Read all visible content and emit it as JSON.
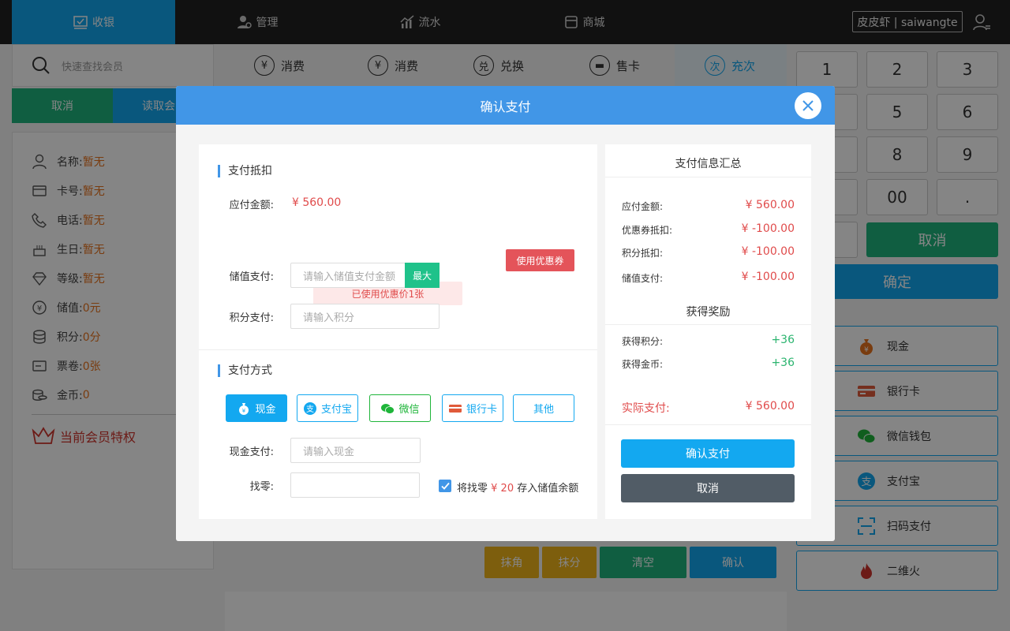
{
  "nav": {
    "items": [
      {
        "label": "收银",
        "icon": "cashier-icon"
      },
      {
        "label": "管理",
        "icon": "manage-icon"
      },
      {
        "label": "流水",
        "icon": "chart-icon"
      },
      {
        "label": "商城",
        "icon": "shop-icon"
      }
    ],
    "user": "皮皮虾 | saiwangte"
  },
  "left": {
    "search_placeholder": "快速查找会员",
    "cancel": "取消",
    "read_card": "读取会",
    "fields": [
      {
        "label": "名称:",
        "value": "暂无",
        "icon": "user-icon"
      },
      {
        "label": "卡号:",
        "value": "暂无",
        "icon": "card-icon"
      },
      {
        "label": "电话:",
        "value": "暂无",
        "icon": "phone-icon"
      },
      {
        "label": "生日:",
        "value": "暂无",
        "icon": "cake-icon"
      },
      {
        "label": "等级:",
        "value": "暂无",
        "icon": "diamond-icon"
      },
      {
        "label": "储值:",
        "value": "0元",
        "icon": "yuan-icon"
      },
      {
        "label": "积分:",
        "value": "0分",
        "icon": "database-icon"
      },
      {
        "label": "票卷:",
        "value": "0张",
        "icon": "ticket-icon"
      },
      {
        "label": "金币:",
        "value": "0",
        "icon": "coins-icon"
      }
    ],
    "privilege": "当前会员特权"
  },
  "middle": {
    "tabs": [
      {
        "label": "消费",
        "glyph": "¥"
      },
      {
        "label": "消费",
        "glyph": "¥"
      },
      {
        "label": "兑换",
        "glyph": "兑"
      },
      {
        "label": "售卡",
        "glyph": "▬"
      },
      {
        "label": "充次",
        "glyph": "次"
      }
    ],
    "buttons": {
      "round_jiao": "抹角",
      "round_fen": "抹分",
      "clear": "清空",
      "confirm": "确认"
    }
  },
  "keypad": {
    "keys": [
      "1",
      "2",
      "3",
      "5",
      "6",
      "8",
      "9",
      "00",
      "."
    ],
    "cancel": "取消",
    "ok": "确定",
    "methods": [
      "现金",
      "银行卡",
      "微信钱包",
      "支付宝",
      "扫码支付",
      "二维火"
    ]
  },
  "modal": {
    "title": "确认支付",
    "deduct_title": "支付抵扣",
    "due_label": "应付金额:",
    "due_value": "¥ 560.00",
    "use_coupon": "使用优惠券",
    "coupon_used": "已使用优惠价1张",
    "stored_label": "储值支付:",
    "stored_placeholder": "请输入储值支付金额",
    "max": "最大",
    "points_label": "积分支付:",
    "points_placeholder": "请输入积分",
    "method_title": "支付方式",
    "methods": [
      "现金",
      "支付宝",
      "微信",
      "银行卡",
      "其他"
    ],
    "cash_label": "现金支付:",
    "cash_placeholder": "请输入现金",
    "change_label": "找零:",
    "deposit_prefix": "将找零",
    "deposit_amount": "¥ 20",
    "deposit_suffix": "存入储值余额",
    "summary": {
      "title": "支付信息汇总",
      "rows": [
        {
          "label": "应付金额:",
          "value": "¥ 560.00"
        },
        {
          "label": "优惠券抵扣:",
          "value": "¥ -100.00"
        },
        {
          "label": "积分抵扣:",
          "value": "¥ -100.00"
        },
        {
          "label": "储值支付:",
          "value": "¥ -100.00"
        }
      ],
      "reward_title": "获得奖励",
      "rewards": [
        {
          "label": "获得积分:",
          "value": "+36"
        },
        {
          "label": "获得金币:",
          "value": "+36"
        }
      ],
      "actual_label": "实际支付:",
      "actual_value": "¥ 560.00",
      "confirm": "确认支付",
      "cancel": "取消"
    }
  },
  "colors": {
    "accent": "#13a8f0",
    "green": "#1fb57e",
    "red": "#e04b4b",
    "header": "#4196e7"
  }
}
